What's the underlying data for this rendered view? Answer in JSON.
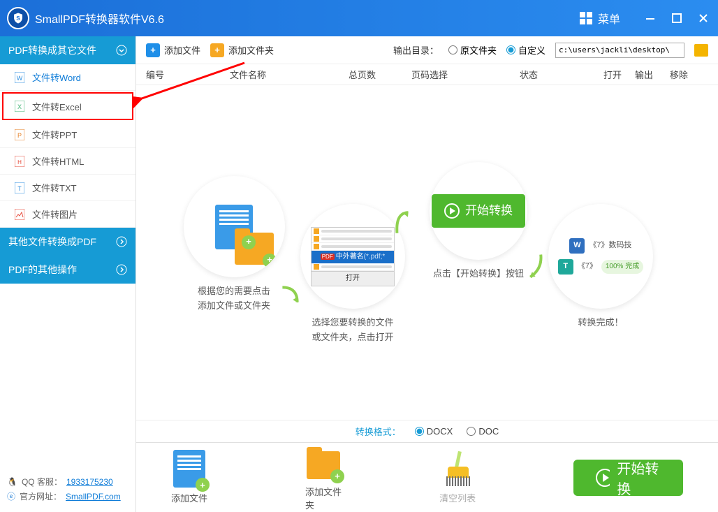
{
  "app": {
    "title": "SmallPDF转换器软件V6.6",
    "menu": "菜单"
  },
  "sidebar": {
    "header1": "PDF转换成其它文件",
    "items": [
      {
        "label": "文件转Word",
        "color": "#2f8fe0"
      },
      {
        "label": "文件转Excel",
        "color": "#3cb371"
      },
      {
        "label": "文件转PPT",
        "color": "#e67e22"
      },
      {
        "label": "文件转HTML",
        "color": "#e74c3c"
      },
      {
        "label": "文件转TXT",
        "color": "#2f8fe0"
      },
      {
        "label": "文件转图片",
        "color": "#e74c3c"
      }
    ],
    "header2": "其他文件转换成PDF",
    "header3": "PDF的其他操作"
  },
  "footer": {
    "qq_label": "QQ 客服：",
    "qq": "1933175230",
    "site_label": "官方网址：",
    "site": "SmallPDF.com"
  },
  "toolbar": {
    "add_file": "添加文件",
    "add_folder": "添加文件夹",
    "output_label": "输出目录：",
    "opt_orig": "原文件夹",
    "opt_custom": "自定义",
    "path": "c:\\users\\jackli\\desktop\\"
  },
  "columns": {
    "no": "编号",
    "name": "文件名称",
    "pages": "总页数",
    "range": "页码选择",
    "status": "状态",
    "open": "打开",
    "out": "输出",
    "rm": "移除"
  },
  "steps": {
    "s1": "根据您的需要点击\n添加文件或文件夹",
    "s2": "选择您要转换的文件\n或文件夹，点击打开",
    "s3_btn": "开始转换",
    "s3": "点击【开始转换】按钮",
    "s4": "转换完成！",
    "mini_title": "中外著名",
    "mini_filter": "(*.pdf;*",
    "mini_open": "打开",
    "res1": "《7》数码技",
    "res2": "《7》",
    "done": "100% 完成"
  },
  "format": {
    "label": "转换格式：",
    "docx": "DOCX",
    "doc": "DOC"
  },
  "bottom": {
    "add_file": "添加文件",
    "add_folder": "添加文件夹",
    "clear": "清空列表",
    "start": "开始转换"
  }
}
